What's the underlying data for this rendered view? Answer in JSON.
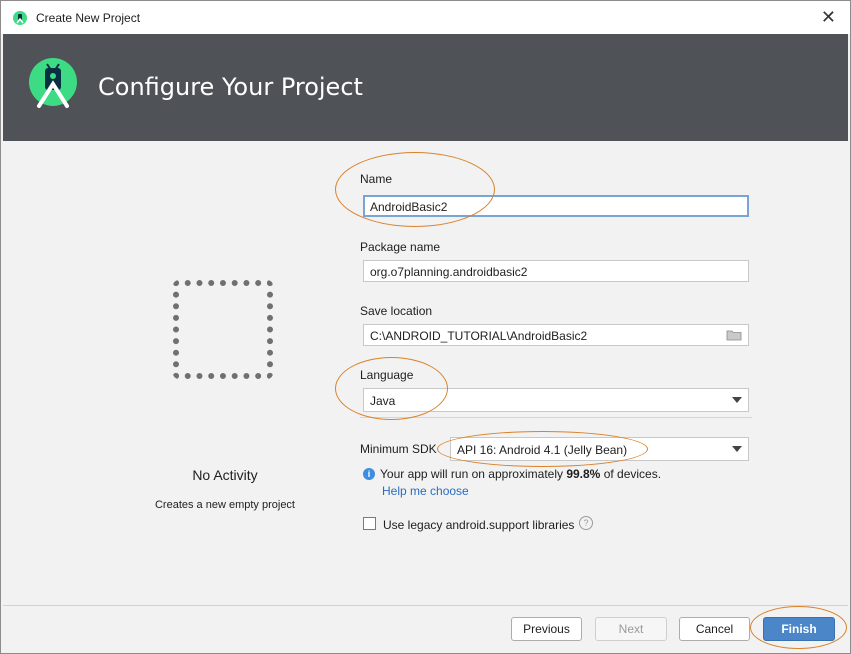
{
  "window": {
    "title": "Create New Project",
    "close_glyph": "✕"
  },
  "header": {
    "title": "Configure Your Project"
  },
  "activity": {
    "name": "No Activity",
    "description": "Creates a new empty project"
  },
  "form": {
    "name_label": "Name",
    "name_value": "AndroidBasic2",
    "package_label": "Package name",
    "package_value": "org.o7planning.androidbasic2",
    "location_label": "Save location",
    "location_value": "C:\\ANDROID_TUTORIAL\\AndroidBasic2",
    "language_label": "Language",
    "language_value": "Java",
    "sdk_label": "Minimum SDK",
    "sdk_value": "API 16: Android 4.1 (Jelly Bean)",
    "info_prefix": "Your app will run on approximately ",
    "info_percent": "99.8%",
    "info_suffix": " of devices.",
    "help_link": "Help me choose",
    "legacy_label": "Use legacy android.support libraries",
    "legacy_checked": false
  },
  "buttons": {
    "previous": "Previous",
    "next": "Next",
    "cancel": "Cancel",
    "finish": "Finish"
  },
  "colors": {
    "header_bg": "#4f5357",
    "accent": "#4a86c8",
    "annotation": "#d9822b",
    "android_green": "#3ddc84"
  }
}
